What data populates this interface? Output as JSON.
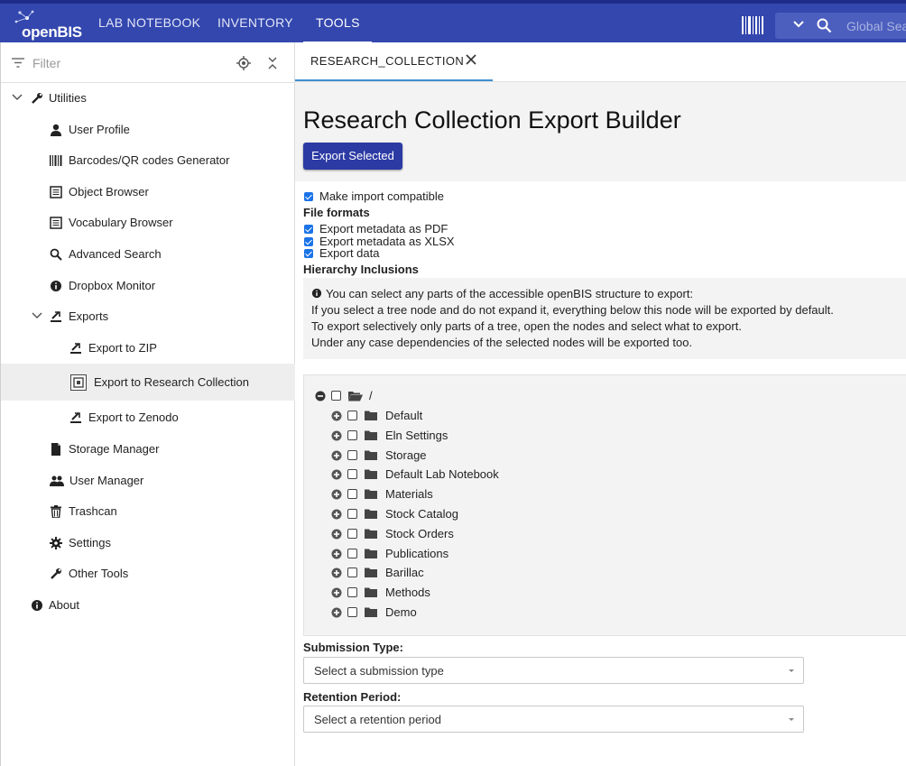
{
  "app": {
    "logo_text": "openBIS",
    "nav": [
      "LAB NOTEBOOK",
      "INVENTORY",
      "TOOLS"
    ],
    "search_placeholder": "Global Search"
  },
  "sidebar": {
    "filter_placeholder": "Filter",
    "items": [
      {
        "label": "Utilities",
        "icon": "wrench-icon"
      },
      {
        "label": "User Profile",
        "icon": "user-icon"
      },
      {
        "label": "Barcodes/QR codes Generator",
        "icon": "barcode-icon"
      },
      {
        "label": "Object Browser",
        "icon": "list-icon"
      },
      {
        "label": "Vocabulary Browser",
        "icon": "list-icon"
      },
      {
        "label": "Advanced Search",
        "icon": "search-icon"
      },
      {
        "label": "Dropbox Monitor",
        "icon": "info-icon"
      },
      {
        "label": "Exports",
        "icon": "export-icon"
      },
      {
        "label": "Export to ZIP",
        "icon": "export-icon"
      },
      {
        "label": "Export to Research Collection",
        "icon": "research-collection-icon"
      },
      {
        "label": "Export to Zenodo",
        "icon": "export-icon"
      },
      {
        "label": "Storage Manager",
        "icon": "file-icon"
      },
      {
        "label": "User Manager",
        "icon": "users-icon"
      },
      {
        "label": "Trashcan",
        "icon": "trash-icon"
      },
      {
        "label": "Settings",
        "icon": "gear-icon"
      },
      {
        "label": "Other Tools",
        "icon": "wrench-icon"
      },
      {
        "label": "About",
        "icon": "info-icon"
      }
    ]
  },
  "tab": {
    "label": "RESEARCH_COLLECTION"
  },
  "main": {
    "title": "Research Collection Export Builder",
    "export_button": "Export Selected",
    "make_import_compatible": "Make import compatible",
    "file_formats_heading": "File formats",
    "formats": [
      "Export metadata as PDF",
      "Export metadata as XLSX",
      "Export data"
    ],
    "hierarchy_heading": "Hierarchy Inclusions",
    "info_lines": [
      "You can select any parts of the accessible openBIS structure to export:",
      "If you select a tree node and do not expand it, everything below this node will be exported by default.",
      "To export selectively only parts of a tree, open the nodes and select what to export.",
      "Under any case dependencies of the selected nodes will be exported too."
    ],
    "tree_root": "/",
    "tree_nodes": [
      "Default",
      "Eln Settings",
      "Storage",
      "Default Lab Notebook",
      "Materials",
      "Stock Catalog",
      "Stock Orders",
      "Publications",
      "Barillac",
      "Methods",
      "Demo"
    ],
    "submission_type_label": "Submission Type:",
    "submission_type_placeholder": "Select a submission type",
    "retention_period_label": "Retention Period:",
    "retention_period_placeholder": "Select a retention period"
  },
  "colors": {
    "header": "#3347ae",
    "button": "#2c3aa4",
    "accent": "#3e8ed0"
  }
}
